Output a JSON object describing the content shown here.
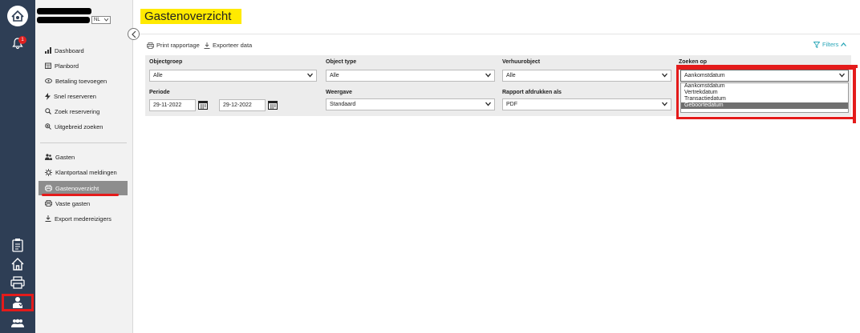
{
  "app": {
    "language": "NL",
    "notification_count": "1"
  },
  "menu": {
    "group1": [
      {
        "label": "Dashboard",
        "icon": "bar-chart-icon"
      },
      {
        "label": "Planbord",
        "icon": "calendar-icon"
      },
      {
        "label": "Betaling toevoegen",
        "icon": "payment-icon"
      },
      {
        "label": "Snel reserveren",
        "icon": "lightning-icon"
      },
      {
        "label": "Zoek reservering",
        "icon": "search-icon"
      },
      {
        "label": "Uitgebreid zoeken",
        "icon": "zoom-icon"
      }
    ],
    "group2": [
      {
        "label": "Gasten",
        "icon": "users-icon"
      },
      {
        "label": "Klantportaal meldingen",
        "icon": "gear-icon"
      },
      {
        "label": "Gastenoverzicht",
        "icon": "printer-icon",
        "active": true
      },
      {
        "label": "Vaste gasten",
        "icon": "printer-icon"
      },
      {
        "label": "Export medereizigers",
        "icon": "download-icon"
      }
    ]
  },
  "page": {
    "title": "Gastenoverzicht"
  },
  "toolbar": {
    "print_label": "Print rapportage",
    "export_label": "Exporteer data",
    "filters_label": "Filters"
  },
  "filters": {
    "objectgroep_label": "Objectgroep",
    "objectgroep_value": "Alle",
    "objecttype_label": "Object type",
    "objecttype_value": "Alle",
    "verhuurobject_label": "Verhuurobject",
    "verhuurobject_value": "Alle",
    "zoeken_op_label": "Zoeken op",
    "zoeken_op_value": "Aankomstdatum",
    "periode_label": "Periode",
    "periode_from": "29-11-2022",
    "periode_to": "29-12-2022",
    "weergave_label": "Weergave",
    "weergave_value": "Standaard",
    "rapport_label": "Rapport afdrukken als",
    "rapport_value": "PDF"
  },
  "dropdown": {
    "options": [
      "Aankomstdatum",
      "Vertrekdatum",
      "Transactiedatum",
      "Geboortedatum"
    ],
    "highlighted": "Geboortedatum"
  },
  "colors": {
    "rail": "#2e3e55",
    "accent": "#2aa7b8",
    "highlight": "#ffea00",
    "annotation_red": "#e41b1b"
  }
}
